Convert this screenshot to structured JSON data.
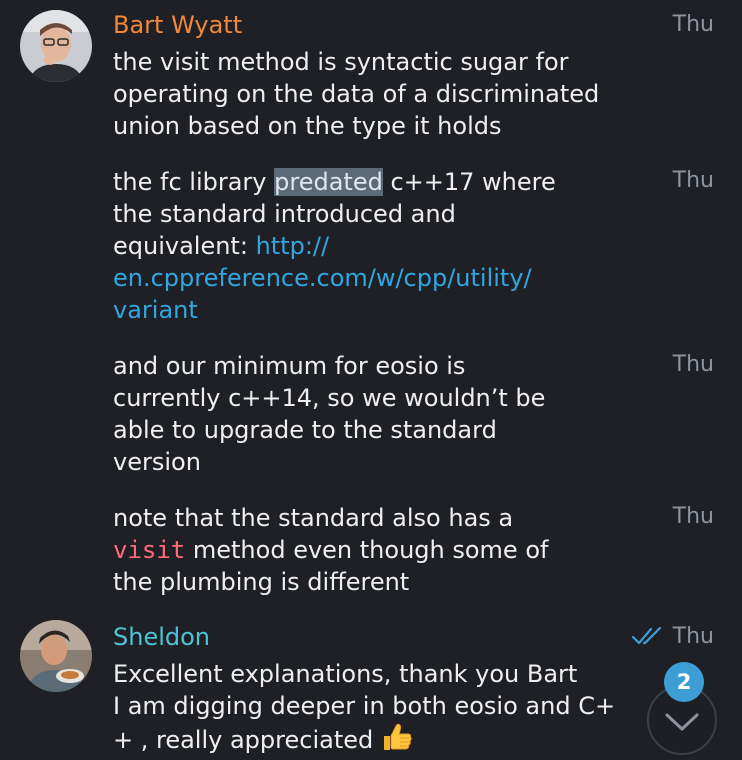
{
  "colors": {
    "background": "#1e2025",
    "bart_name": "#f0873a",
    "sheldon_name": "#4ec3d6",
    "link": "#33a6e0",
    "code": "#ff6b7a",
    "time": "#8d949d",
    "badge": "#3d9ed6"
  },
  "messages": [
    {
      "sender": "Bart Wyatt",
      "time": "Thu",
      "lines": [
        "the visit method is syntactic sugar for",
        "operating on the data of a discriminated",
        "union based on the type it holds"
      ]
    },
    {
      "time": "Thu",
      "line1_before": "the fc library ",
      "line1_highlight": "predated",
      "line1_after": " c++17 where",
      "line2": "the standard introduced and",
      "line3_text": "equivalent: ",
      "link_part1": "http://",
      "link_part2": "en.cppreference.com/w/cpp/utility/",
      "link_part3": "variant"
    },
    {
      "time": "Thu",
      "lines": [
        "and our minimum for eosio is",
        "currently c++14, so we wouldn’t be",
        "able to upgrade to the standard",
        "version"
      ]
    },
    {
      "time": "Thu",
      "line1": "note that the standard also has a",
      "line2_code": "visit",
      "line2_after": " method even though some of",
      "line3": "the plumbing is different"
    },
    {
      "sender": "Sheldon",
      "time": "Thu",
      "read_icon": "double-check-icon",
      "line1": "Excellent explanations, thank you Bart",
      "line2": "I am digging deeper in both eosio and C+",
      "line3": "+ , really appreciated",
      "emoji": "thumbs-up-icon"
    }
  ],
  "scroll_down": {
    "icon": "chevron-down-icon",
    "unread_count": "2"
  }
}
